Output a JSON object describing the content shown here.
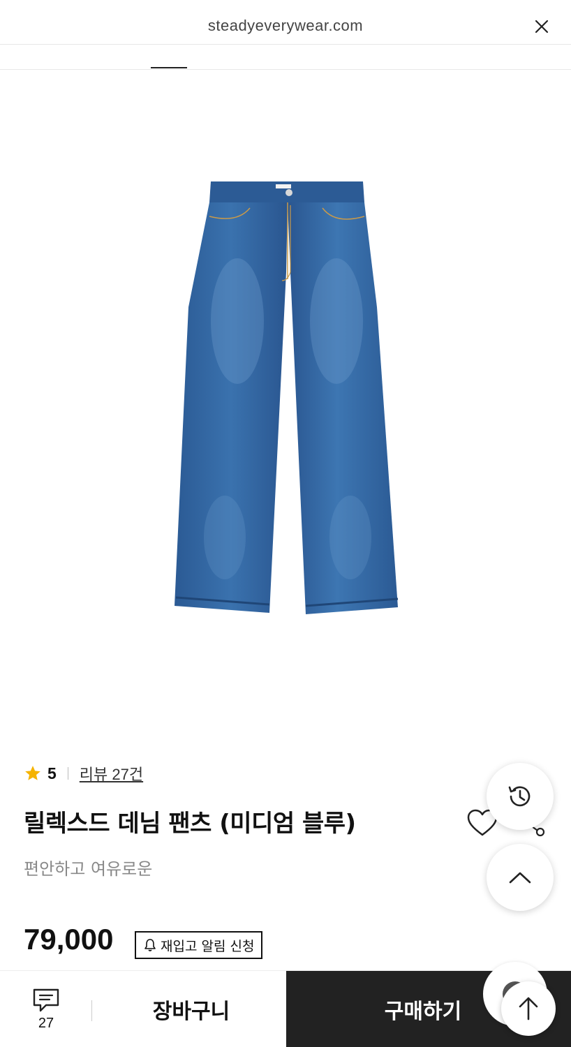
{
  "browser": {
    "url": "steadyeverywear.com",
    "close_icon": "close-icon"
  },
  "product": {
    "rating": "5",
    "review_link": "리뷰 27건",
    "title": "릴렉스드 데님 팬츠 (미디엄 블루)",
    "subtitle": "편안하고 여유로운",
    "price": "79,000",
    "restock_label": "재입고 알림 신청"
  },
  "bottom_bar": {
    "review_count": "27",
    "cart_label": "장바구니",
    "buy_label": "구매하기"
  },
  "icons": {
    "star": "star-icon",
    "wishlist": "heart-icon",
    "share": "share-icon",
    "history": "history-icon",
    "up": "chevron-up-icon",
    "bell": "bell-icon",
    "review": "chat-bubble-icon",
    "scroll_top": "arrow-up-icon"
  },
  "colors": {
    "star": "#F5B301",
    "buy_bg": "#222222",
    "denim": "#2F5F99"
  }
}
